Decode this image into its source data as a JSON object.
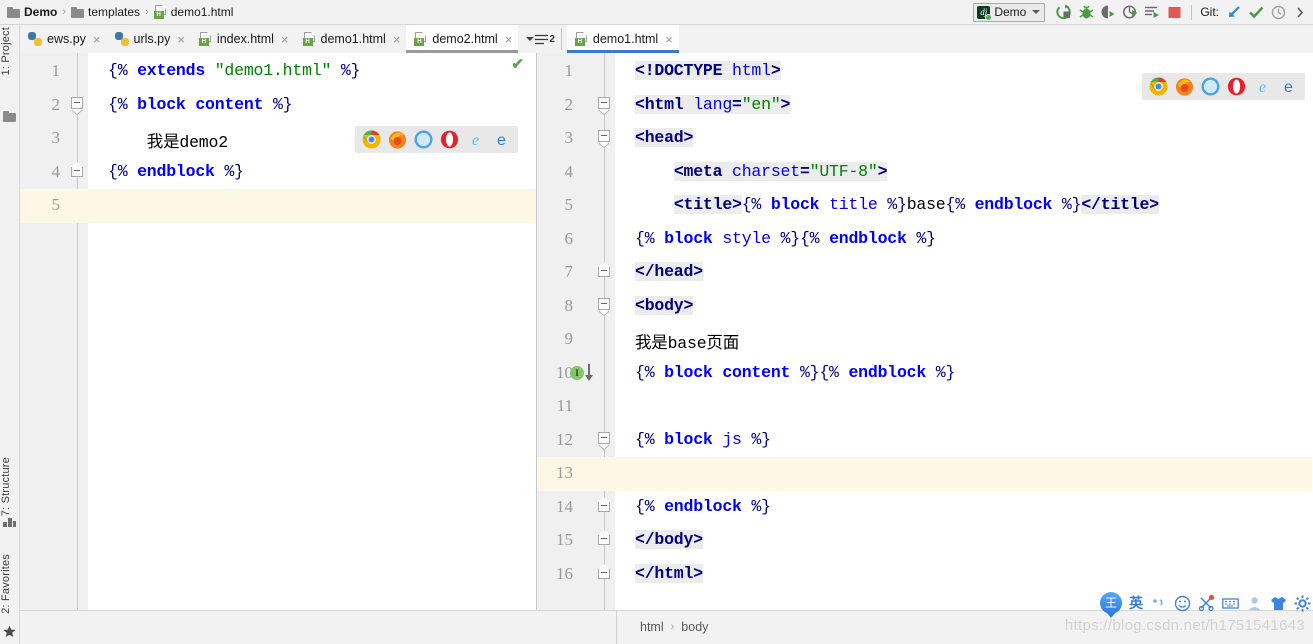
{
  "breadcrumb": {
    "items": [
      {
        "label": "Demo",
        "icon": "folder-icon",
        "bold": true
      },
      {
        "label": "templates",
        "icon": "folder-icon",
        "bold": false
      },
      {
        "label": "demo1.html",
        "icon": "html-file-icon",
        "bold": false
      }
    ],
    "separator": "›"
  },
  "toolbar": {
    "run_config": {
      "label": "Demo",
      "icon": "django-icon"
    },
    "buttons": [
      {
        "name": "run-button",
        "icon": "run-icon"
      },
      {
        "name": "debug-button",
        "icon": "bug-icon"
      },
      {
        "name": "run-coverage-button",
        "icon": "coverage-icon"
      },
      {
        "name": "profile-button",
        "icon": "profile-icon"
      },
      {
        "name": "run-with-console-button",
        "icon": "console-run-icon"
      },
      {
        "name": "stop-button",
        "icon": "stop-square-icon"
      }
    ],
    "git": {
      "label": "Git:",
      "buttons": [
        {
          "name": "git-update-button",
          "icon": "update-project-icon"
        },
        {
          "name": "git-commit-button",
          "icon": "commit-check-icon"
        },
        {
          "name": "git-history-button",
          "icon": "history-clock-icon"
        }
      ]
    }
  },
  "left_tool_strip": {
    "top": [
      {
        "label": "1: Project",
        "icon": "project-folder-icon"
      }
    ],
    "bottom": [
      {
        "label": "7: Structure",
        "icon": "structure-icon"
      },
      {
        "label": "2: Favorites",
        "icon": "star-icon"
      }
    ]
  },
  "tabs": {
    "left_group": [
      {
        "label": "ews.py",
        "icon": "python-file-icon",
        "selected": false
      },
      {
        "label": "urls.py",
        "icon": "python-file-icon",
        "selected": false
      },
      {
        "label": "index.html",
        "icon": "html-file-icon",
        "selected": false
      },
      {
        "label": "demo1.html",
        "icon": "html-file-icon",
        "selected": false
      },
      {
        "label": "demo2.html",
        "icon": "html-file-icon",
        "selected": true
      }
    ],
    "overflow_label": "2",
    "right_group": [
      {
        "label": "demo1.html",
        "icon": "html-file-icon",
        "selected": true
      }
    ],
    "close_glyph": "×"
  },
  "editor_left": {
    "file": "demo2.html",
    "current_line": 5,
    "inspection_status": "ok",
    "lines": [
      {
        "n": 1,
        "fold": "none",
        "tokens": [
          {
            "t": "{% ",
            "c": "dj"
          },
          {
            "t": "extends",
            "c": "kw"
          },
          {
            "t": " ",
            "c": "dj"
          },
          {
            "t": "\"demo1.html\"",
            "c": "str"
          },
          {
            "t": " %}",
            "c": "dj"
          }
        ]
      },
      {
        "n": 2,
        "fold": "open",
        "tokens": [
          {
            "t": "{% ",
            "c": "dj"
          },
          {
            "t": "block",
            "c": "kw"
          },
          {
            "t": " ",
            "c": "dj"
          },
          {
            "t": "content",
            "c": "kw"
          },
          {
            "t": " %}",
            "c": "dj"
          }
        ]
      },
      {
        "n": 3,
        "fold": "none",
        "tokens": [
          {
            "t": "    我是demo2",
            "c": "txt"
          }
        ]
      },
      {
        "n": 4,
        "fold": "end",
        "tokens": [
          {
            "t": "{% ",
            "c": "dj"
          },
          {
            "t": "endblock",
            "c": "kw"
          },
          {
            "t": " %}",
            "c": "dj"
          }
        ]
      },
      {
        "n": 5,
        "fold": "none",
        "tokens": []
      }
    ],
    "browser_popup": [
      "chrome-icon",
      "firefox-icon",
      "safari-icon",
      "opera-icon",
      "ie-icon",
      "edge-icon"
    ]
  },
  "editor_right": {
    "file": "demo1.html",
    "current_line": 13,
    "lines": [
      {
        "n": 1,
        "fold": "none",
        "tokens": [
          {
            "t": "<!DOCTYPE ",
            "c": "tag hl"
          },
          {
            "t": "html",
            "c": "attr hl"
          },
          {
            "t": ">",
            "c": "tag hl"
          }
        ]
      },
      {
        "n": 2,
        "fold": "open",
        "tokens": [
          {
            "t": "<html ",
            "c": "tag hl"
          },
          {
            "t": "lang",
            "c": "attr hl"
          },
          {
            "t": "=",
            "c": "tag hl"
          },
          {
            "t": "\"en\"",
            "c": "str hl"
          },
          {
            "t": ">",
            "c": "tag hl"
          }
        ]
      },
      {
        "n": 3,
        "fold": "open",
        "tokens": [
          {
            "t": "<head>",
            "c": "tag hl"
          }
        ]
      },
      {
        "n": 4,
        "fold": "none",
        "tokens": [
          {
            "t": "    ",
            "c": "txt"
          },
          {
            "t": "<meta ",
            "c": "tag hl"
          },
          {
            "t": "charset",
            "c": "attr hl"
          },
          {
            "t": "=",
            "c": "tag hl"
          },
          {
            "t": "\"UTF-8\"",
            "c": "str hl"
          },
          {
            "t": ">",
            "c": "tag hl"
          }
        ]
      },
      {
        "n": 5,
        "fold": "none",
        "tokens": [
          {
            "t": "    ",
            "c": "txt"
          },
          {
            "t": "<title>",
            "c": "tag hl"
          },
          {
            "t": "{% ",
            "c": "dj"
          },
          {
            "t": "block",
            "c": "kw"
          },
          {
            "t": " ",
            "c": "dj"
          },
          {
            "t": "title",
            "c": "attr"
          },
          {
            "t": " %}",
            "c": "dj"
          },
          {
            "t": "base",
            "c": "txt"
          },
          {
            "t": "{% ",
            "c": "dj"
          },
          {
            "t": "endblock",
            "c": "kw"
          },
          {
            "t": " %}",
            "c": "dj"
          },
          {
            "t": "</title>",
            "c": "tag hl"
          }
        ]
      },
      {
        "n": 6,
        "fold": "none",
        "tokens": [
          {
            "t": "{% ",
            "c": "dj"
          },
          {
            "t": "block",
            "c": "kw"
          },
          {
            "t": " ",
            "c": "dj"
          },
          {
            "t": "style",
            "c": "attr"
          },
          {
            "t": " %}{% ",
            "c": "dj"
          },
          {
            "t": "endblock",
            "c": "kw"
          },
          {
            "t": " %}",
            "c": "dj"
          }
        ]
      },
      {
        "n": 7,
        "fold": "end",
        "tokens": [
          {
            "t": "</head>",
            "c": "tag hl"
          }
        ]
      },
      {
        "n": 8,
        "fold": "open",
        "tokens": [
          {
            "t": "<body>",
            "c": "tag hl"
          }
        ]
      },
      {
        "n": 9,
        "fold": "none",
        "tokens": [
          {
            "t": "我是base页面",
            "c": "txt"
          }
        ]
      },
      {
        "n": 10,
        "fold": "none",
        "marker": "implementation-marker",
        "tokens": [
          {
            "t": "{% ",
            "c": "dj"
          },
          {
            "t": "block",
            "c": "kw"
          },
          {
            "t": " ",
            "c": "dj"
          },
          {
            "t": "content",
            "c": "kw"
          },
          {
            "t": " %}{% ",
            "c": "dj"
          },
          {
            "t": "endblock",
            "c": "kw"
          },
          {
            "t": " %}",
            "c": "dj"
          }
        ]
      },
      {
        "n": 11,
        "fold": "none",
        "tokens": []
      },
      {
        "n": 12,
        "fold": "open",
        "tokens": [
          {
            "t": "{% ",
            "c": "dj"
          },
          {
            "t": "block",
            "c": "kw"
          },
          {
            "t": " ",
            "c": "dj"
          },
          {
            "t": "js",
            "c": "attr"
          },
          {
            "t": " %}",
            "c": "dj"
          }
        ]
      },
      {
        "n": 13,
        "fold": "none",
        "tokens": []
      },
      {
        "n": 14,
        "fold": "end",
        "tokens": [
          {
            "t": "{% ",
            "c": "dj"
          },
          {
            "t": "endblock",
            "c": "kw"
          },
          {
            "t": " %}",
            "c": "dj"
          }
        ]
      },
      {
        "n": 15,
        "fold": "end",
        "tokens": [
          {
            "t": "</body>",
            "c": "tag hl"
          }
        ]
      },
      {
        "n": 16,
        "fold": "end",
        "tokens": [
          {
            "t": "</html>",
            "c": "tag hl"
          }
        ]
      }
    ],
    "browser_popup": [
      "chrome-icon",
      "firefox-icon",
      "safari-icon",
      "opera-icon",
      "ie-icon",
      "edge-icon"
    ]
  },
  "statusbar": {
    "element_path": [
      "html",
      "body"
    ],
    "separator": "›"
  },
  "ime": {
    "logo_glyph": "王",
    "mode_label": "英",
    "icons": [
      "comma-icon",
      "emoji-icon",
      "scissors-icon",
      "keyboard-icon",
      "user-icon",
      "skin-icon",
      "settings-gear-icon"
    ]
  },
  "watermark": "https://blog.csdn.net/h1751541643",
  "colors": {
    "accent_blue": "#3a7cc4",
    "tab_selected_gray": "#9a9a9a",
    "current_line": "#fdf8e6",
    "keyword": "#0000ff",
    "string": "#008000",
    "tag": "#000080",
    "attribute": "#0000ee",
    "gutter_bg": "#f0f0f0",
    "chrome_bg": "#f2f2f2"
  }
}
